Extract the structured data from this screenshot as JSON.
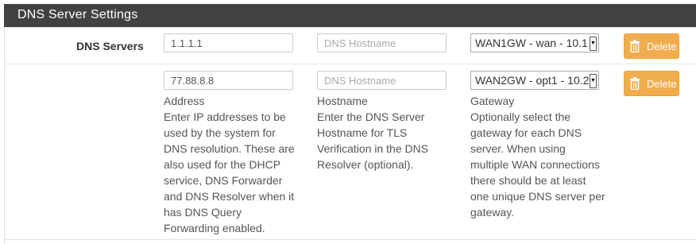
{
  "section": {
    "title": "DNS Server Settings"
  },
  "dns_servers_label": "DNS Servers",
  "rows": [
    {
      "address": "1.1.1.1",
      "hostname_placeholder": "DNS Hostname",
      "gateway": "WAN1GW - wan - 10.1",
      "delete_label": "Delete"
    },
    {
      "address": "77.88.8.8",
      "hostname_placeholder": "DNS Hostname",
      "gateway": "WAN2GW - opt1 - 10.2",
      "delete_label": "Delete"
    }
  ],
  "help": {
    "address_title": "Address",
    "address_lines": [
      "Enter IP addresses to be",
      "used by the system for",
      "DNS resolution. These are",
      "also used for the DHCP",
      "service, DNS Forwarder",
      "and DNS Resolver when it",
      "has DNS Query",
      "Forwarding enabled."
    ],
    "hostname_title": "Hostname",
    "hostname_lines": [
      "Enter the DNS Server",
      "Hostname for TLS",
      "Verification in the DNS",
      "Resolver (optional)."
    ],
    "gateway_title": "Gateway",
    "gateway_lines": [
      "Optionally select the",
      "gateway for each DNS",
      "server. When using",
      "multiple WAN connections",
      "there should be at least",
      "one unique DNS server per",
      "gateway."
    ]
  },
  "colors": {
    "header_bg": "#424242",
    "delete_button": "#f0ad4e"
  }
}
